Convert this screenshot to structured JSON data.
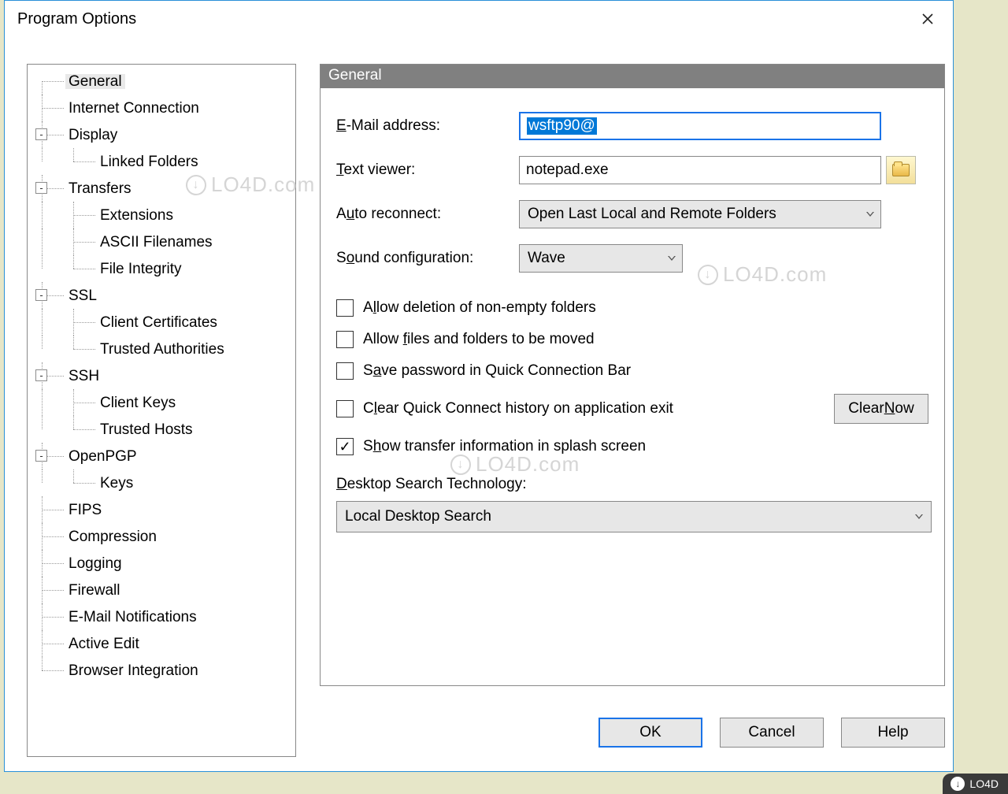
{
  "window": {
    "title": "Program Options"
  },
  "tree": {
    "items": [
      {
        "label": "General",
        "depth": 0,
        "selected": true
      },
      {
        "label": "Internet Connection",
        "depth": 0
      },
      {
        "label": "Display",
        "depth": 0,
        "toggle": "-"
      },
      {
        "label": "Linked Folders",
        "depth": 1,
        "last": true
      },
      {
        "label": "Transfers",
        "depth": 0,
        "toggle": "-"
      },
      {
        "label": "Extensions",
        "depth": 1
      },
      {
        "label": "ASCII Filenames",
        "depth": 1
      },
      {
        "label": "File Integrity",
        "depth": 1,
        "last": true
      },
      {
        "label": "SSL",
        "depth": 0,
        "toggle": "-"
      },
      {
        "label": "Client Certificates",
        "depth": 1
      },
      {
        "label": "Trusted Authorities",
        "depth": 1,
        "last": true
      },
      {
        "label": "SSH",
        "depth": 0,
        "toggle": "-"
      },
      {
        "label": "Client Keys",
        "depth": 1
      },
      {
        "label": "Trusted Hosts",
        "depth": 1,
        "last": true
      },
      {
        "label": "OpenPGP",
        "depth": 0,
        "toggle": "-"
      },
      {
        "label": "Keys",
        "depth": 1,
        "last": true
      },
      {
        "label": "FIPS",
        "depth": 0
      },
      {
        "label": "Compression",
        "depth": 0
      },
      {
        "label": "Logging",
        "depth": 0
      },
      {
        "label": "Firewall",
        "depth": 0
      },
      {
        "label": "E-Mail Notifications",
        "depth": 0
      },
      {
        "label": "Active Edit",
        "depth": 0
      },
      {
        "label": "Browser Integration",
        "depth": 0,
        "last": true
      }
    ]
  },
  "panel": {
    "header": "General",
    "labels": {
      "email_pre": "E",
      "email_post": "-Mail address:",
      "textviewer_pre": "T",
      "textviewer_post": "ext viewer:",
      "autoreconnect_pre": "A",
      "autoreconnect_u": "u",
      "autoreconnect_post": "to reconnect:",
      "sound_pre": "S",
      "sound_u": "o",
      "sound_post": "und configuration:",
      "dst_pre": "D",
      "dst_post": "esktop Search Technology:"
    },
    "fields": {
      "email": "wsftp90@",
      "text_viewer": "notepad.exe",
      "auto_reconnect": "Open Last Local and Remote Folders",
      "sound": "Wave",
      "desktop_search": "Local Desktop Search"
    },
    "checkboxes": {
      "allow_delete": {
        "checked": false,
        "pre": "A",
        "u": "l",
        "post": "low deletion of non-empty folders"
      },
      "allow_move": {
        "checked": false,
        "pre": "Allow ",
        "u": "f",
        "post": "iles and folders to be moved"
      },
      "save_pw": {
        "checked": false,
        "pre": "S",
        "u": "a",
        "post": "ve password in Quick Connection Bar"
      },
      "clear_hist": {
        "checked": false,
        "pre": "C",
        "u": "l",
        "post": "ear Quick Connect history on application exit"
      },
      "show_splash": {
        "checked": true,
        "pre": "S",
        "u": "h",
        "post": "ow transfer information in splash screen"
      }
    },
    "buttons": {
      "clear_now_pre": "Clear ",
      "clear_now_u": "N",
      "clear_now_post": "ow",
      "ok": "OK",
      "cancel": "Cancel",
      "help": "Help"
    }
  },
  "watermark": "LO4D.com",
  "badge": "LO4D"
}
